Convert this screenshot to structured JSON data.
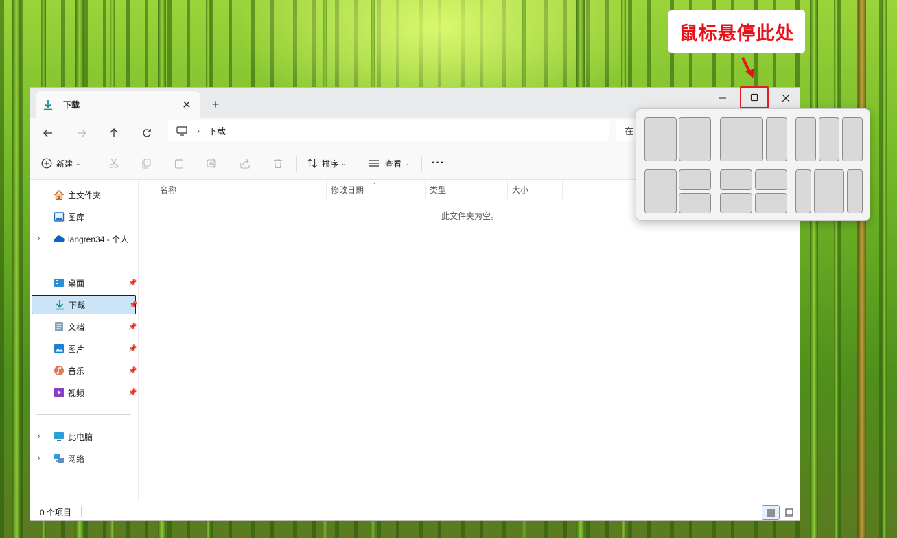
{
  "callout": {
    "text": "鼠标悬停此处"
  },
  "tab": {
    "title": "下载",
    "close_glyph": "✕",
    "new_tab_glyph": "+"
  },
  "window_controls": {
    "minimize": "—",
    "close": "✕"
  },
  "address": {
    "crumb": "下载"
  },
  "search": {
    "placeholder_partial": "在"
  },
  "toolbar": {
    "new_label": "新建",
    "sort_label": "排序",
    "view_label": "查看",
    "more_glyph": "···"
  },
  "sidebar": {
    "items": [
      {
        "label": "主文件夹",
        "icon": "home-icon"
      },
      {
        "label": "图库",
        "icon": "gallery-icon"
      },
      {
        "label": "langren34 - 个人",
        "icon": "onedrive-cloud-icon",
        "expandable": true
      },
      {
        "label": "桌面",
        "icon": "desktop-icon",
        "pinned": true
      },
      {
        "label": "下载",
        "icon": "download-icon",
        "pinned": true,
        "selected": true
      },
      {
        "label": "文档",
        "icon": "documents-icon",
        "pinned": true
      },
      {
        "label": "图片",
        "icon": "pictures-icon",
        "pinned": true
      },
      {
        "label": "音乐",
        "icon": "music-icon",
        "pinned": true
      },
      {
        "label": "视频",
        "icon": "videos-icon",
        "pinned": true
      },
      {
        "label": "此电脑",
        "icon": "this-pc-icon",
        "expandable": true
      },
      {
        "label": "网络",
        "icon": "network-icon",
        "expandable": true
      }
    ]
  },
  "columns": [
    "名称",
    "修改日期",
    "类型",
    "大小"
  ],
  "empty_message": "此文件夹为空。",
  "status": {
    "item_count": "0 个项目"
  },
  "colors": {
    "accent": "#0078d4",
    "callout_red": "#e8121b",
    "selection": "#cce4f7"
  }
}
